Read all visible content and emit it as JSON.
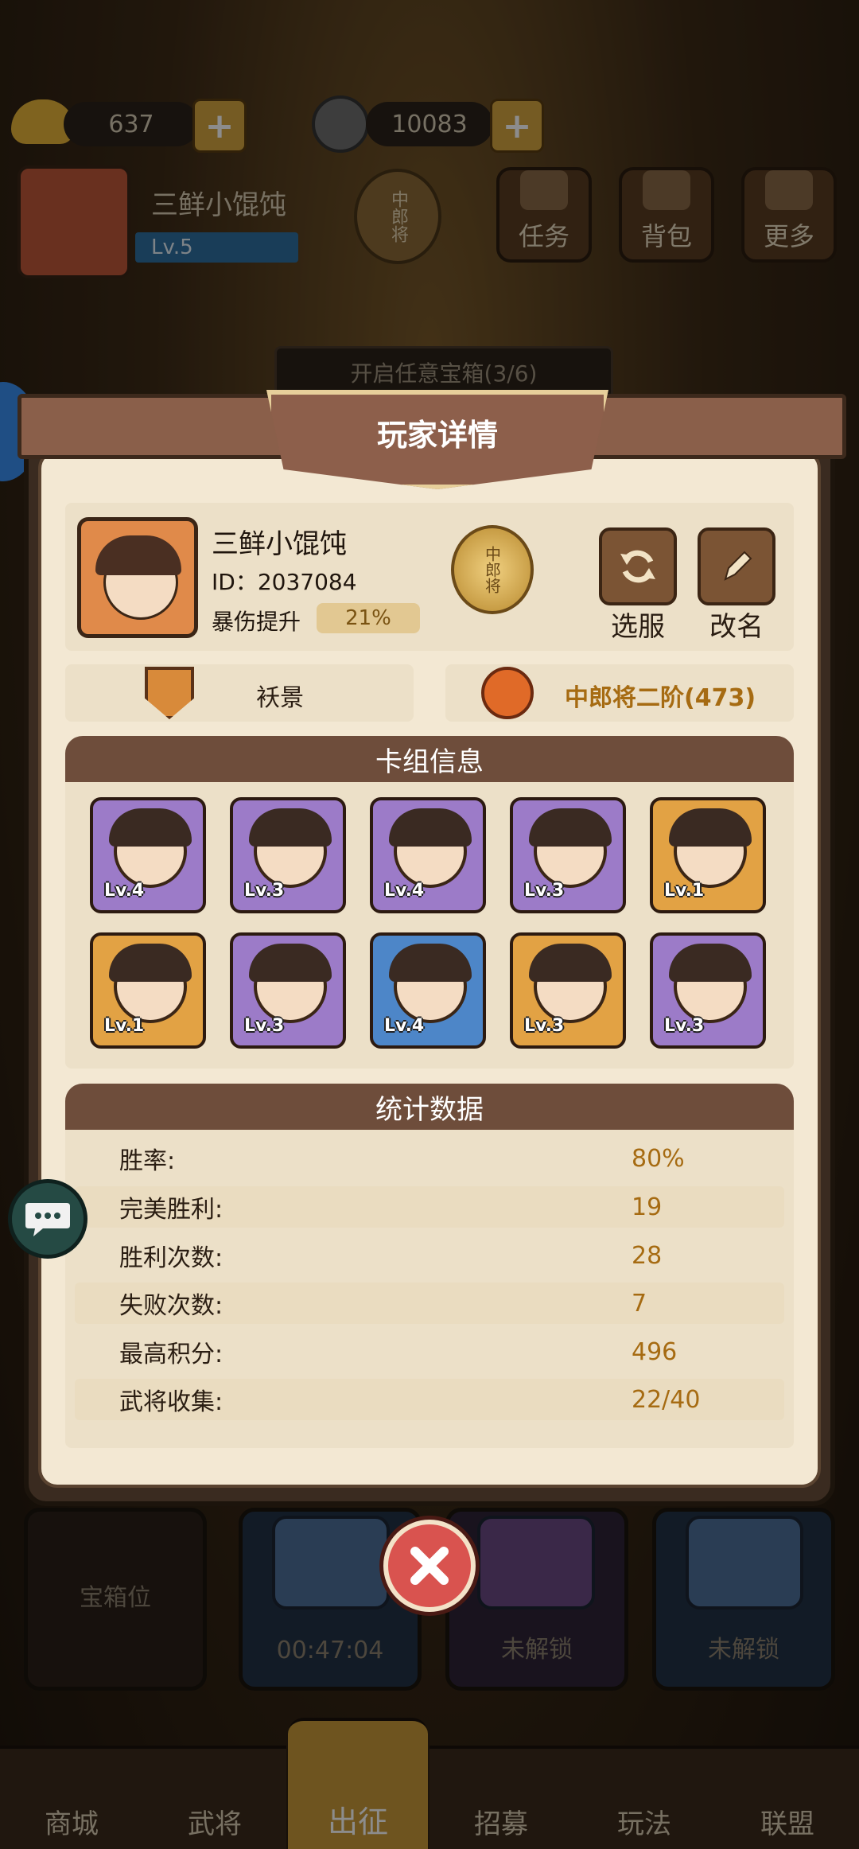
{
  "resources": {
    "gold": "637",
    "coins": "10083"
  },
  "player_header": {
    "name": "三鲜小馄饨",
    "level": "Lv.5",
    "rank_badge": "中郎将"
  },
  "top_buttons": [
    {
      "label": "任务"
    },
    {
      "label": "背包"
    },
    {
      "label": "更多"
    }
  ],
  "quest_banner": "开启任意宝箱(3/6)",
  "chest_slots": [
    {
      "label": "宝箱位"
    },
    {
      "label": "00:47:04"
    },
    {
      "label": "未解锁"
    },
    {
      "label": "未解锁"
    }
  ],
  "bottom_nav": [
    {
      "label": "商城"
    },
    {
      "label": "武将"
    },
    {
      "label": "出征"
    },
    {
      "label": "招募"
    },
    {
      "label": "玩法"
    },
    {
      "label": "联盟"
    }
  ],
  "modal": {
    "title": "玩家详情",
    "player": {
      "name": "三鲜小馄饨",
      "id_text": "ID：2037084",
      "crit_label": "暴伤提升",
      "crit_value": "21%",
      "rank_badge": "中郎将"
    },
    "buttons": {
      "switch_server": "选服",
      "rename": "改名"
    },
    "guild": "袄景",
    "rank_text": "中郎将二阶(473)",
    "deck_title": "卡组信息",
    "cards": [
      {
        "level": "Lv.4",
        "rarity": "purple"
      },
      {
        "level": "Lv.3",
        "rarity": "purple"
      },
      {
        "level": "Lv.4",
        "rarity": "purple"
      },
      {
        "level": "Lv.3",
        "rarity": "purple"
      },
      {
        "level": "Lv.1",
        "rarity": "orange"
      },
      {
        "level": "Lv.1",
        "rarity": "orange"
      },
      {
        "level": "Lv.3",
        "rarity": "purple"
      },
      {
        "level": "Lv.4",
        "rarity": "blue"
      },
      {
        "level": "Lv.3",
        "rarity": "orange"
      },
      {
        "level": "Lv.3",
        "rarity": "purple"
      }
    ],
    "stats_title": "统计数据",
    "stats": [
      {
        "label": "胜率:",
        "value": "80%"
      },
      {
        "label": "完美胜利:",
        "value": "19"
      },
      {
        "label": "胜利次数:",
        "value": "28"
      },
      {
        "label": "失败次数:",
        "value": "7"
      },
      {
        "label": "最高积分:",
        "value": "496"
      },
      {
        "label": "武将收集:",
        "value": "22/40"
      }
    ]
  },
  "colors": {
    "accent_gold": "#a66b12",
    "header_brown": "#6e4d3b",
    "close_red": "#d9534f"
  }
}
